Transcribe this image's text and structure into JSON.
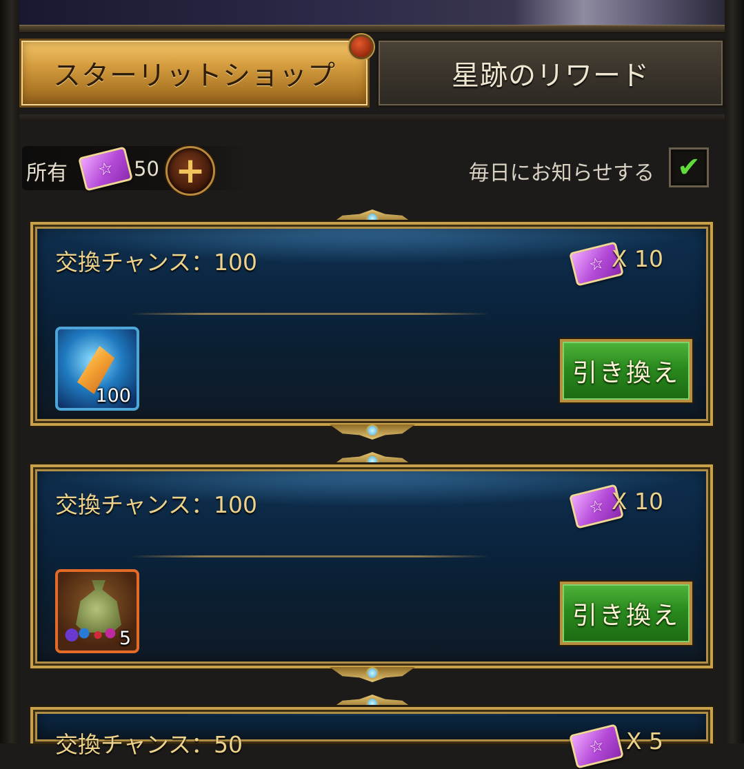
{
  "tabs": {
    "active_label": "スターリットショップ",
    "inactive_label": "星跡のリワード"
  },
  "currency": {
    "owned_label": "所有",
    "owned_count": "50",
    "add_symbol": "+"
  },
  "notify": {
    "label": "毎日にお知らせする",
    "checked": true
  },
  "cards": [
    {
      "title": "交換チャンス：100",
      "cost": "X 10",
      "item_icon": "orange-crystal-shard",
      "item_qty": "100",
      "redeem_label": "引き換え"
    },
    {
      "title": "交換チャンス：100",
      "cost": "X 10",
      "item_icon": "green-gem-pouch",
      "item_qty": "5",
      "redeem_label": "引き換え"
    },
    {
      "title": "交換チャンス：50",
      "cost": "X 5"
    }
  ],
  "colors": {
    "gold_text": "#ecd28a",
    "active_tab": "#d39b3e",
    "redeem_green": "#2a8a1e",
    "card_blue": "#0b2540"
  }
}
